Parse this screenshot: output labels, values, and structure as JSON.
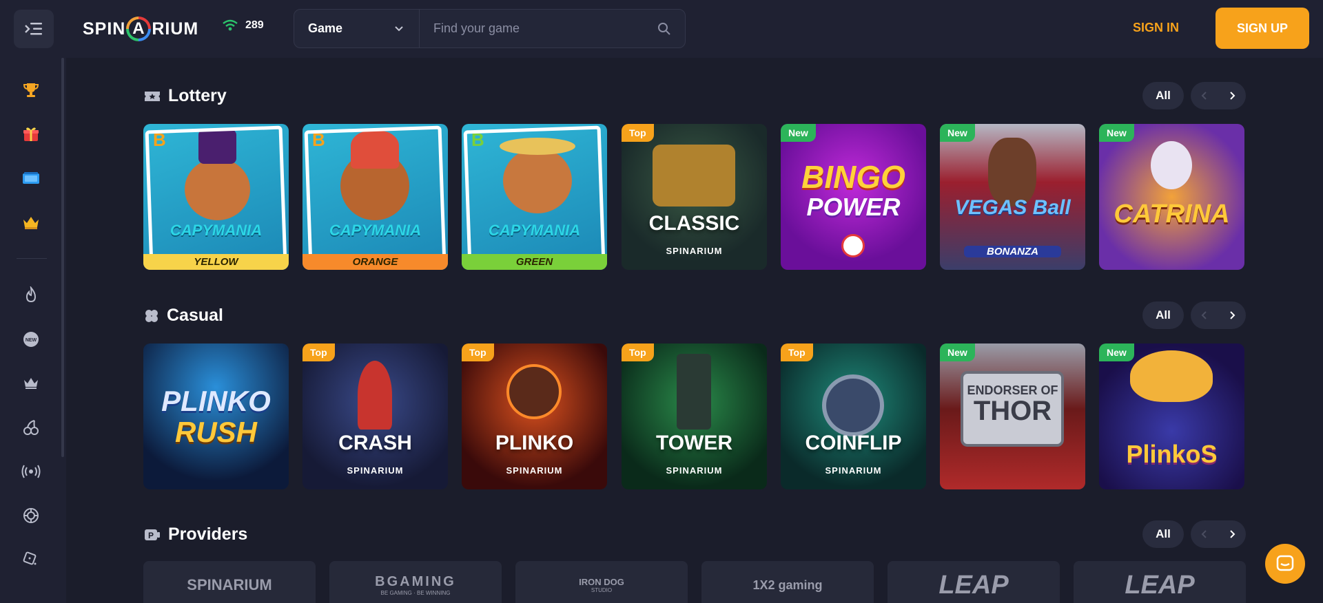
{
  "header": {
    "logo_text_left": "SPIN",
    "logo_text_mid": "A",
    "logo_text_right": "RIUM",
    "online_count": "289",
    "game_select_value": "Game",
    "search_placeholder": "Find your game",
    "signin_label": "SIGN IN",
    "signup_label": "SIGN UP"
  },
  "colors": {
    "accent": "#f7a21b",
    "new_badge": "#2cb45a",
    "background": "#1b1d2b",
    "panel": "#1f2132"
  },
  "sidebar": {
    "icons": [
      "trophy-icon",
      "gift-icon",
      "ticket-icon",
      "crown-icon",
      "fire-icon",
      "new-icon",
      "crown-outline-icon",
      "cherries-icon",
      "live-icon",
      "roulette-icon",
      "dice-icon"
    ]
  },
  "sections": {
    "lottery": {
      "title": "Lottery",
      "all_label": "All",
      "cards": [
        {
          "name": "capymania-yellow",
          "badge": "",
          "art": "CAPYMANIA",
          "caption": "YELLOW"
        },
        {
          "name": "capymania-orange",
          "badge": "",
          "art": "CAPYMANIA",
          "caption": "ORANGE"
        },
        {
          "name": "capymania-green",
          "badge": "",
          "art": "CAPYMANIA",
          "caption": "GREEN"
        },
        {
          "name": "classic",
          "badge": "Top",
          "art": "CLASSIC",
          "caption": "SPINARIUM"
        },
        {
          "name": "bingo-power",
          "badge": "New",
          "art": "BINGO",
          "caption": "POWER"
        },
        {
          "name": "vegas-ball-bonanza",
          "badge": "New",
          "art": "VEGAS Ball",
          "caption": "BONANZA"
        },
        {
          "name": "catrina",
          "badge": "New",
          "art": "CATRINA",
          "caption": ""
        }
      ]
    },
    "casual": {
      "title": "Casual",
      "all_label": "All",
      "cards": [
        {
          "name": "plinko-rush",
          "badge": "",
          "art": "PLINKO",
          "caption": "RUSH"
        },
        {
          "name": "crash",
          "badge": "Top",
          "art": "CRASH",
          "caption": "SPINARIUM"
        },
        {
          "name": "plinko",
          "badge": "Top",
          "art": "PLINKO",
          "caption": "SPINARIUM"
        },
        {
          "name": "tower",
          "badge": "Top",
          "art": "TOWER",
          "caption": "SPINARIUM"
        },
        {
          "name": "coinflip",
          "badge": "Top",
          "art": "COINFLIP",
          "caption": "SPINARIUM"
        },
        {
          "name": "endorser-of-thor",
          "badge": "New",
          "art": "ENDORSER OF",
          "caption": "THOR"
        },
        {
          "name": "plinkos",
          "badge": "New",
          "art": "PlinkoS",
          "caption": ""
        }
      ]
    },
    "providers": {
      "title": "Providers",
      "all_label": "All",
      "items": [
        "SPINARIUM",
        "BGAMING",
        "IRON DOG",
        "1X2 gaming",
        "LEAP",
        "LEAP"
      ],
      "bgaming_tagline": "BE GAMING · BE WINNING",
      "irondog_tagline": "STUDIO"
    }
  }
}
